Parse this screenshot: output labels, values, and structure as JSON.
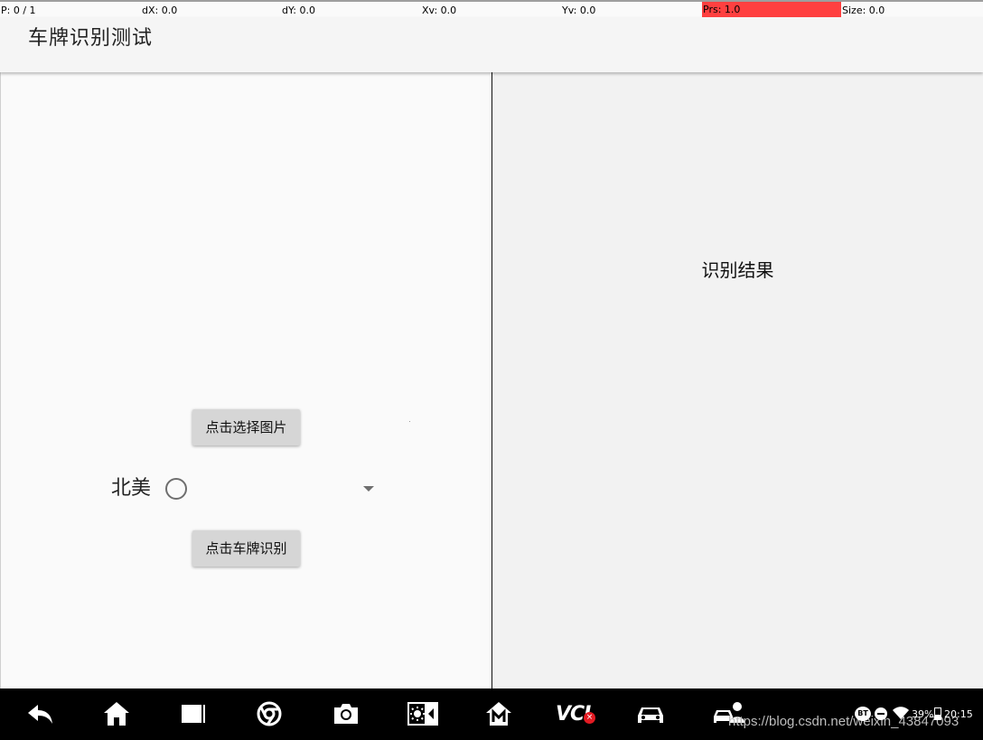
{
  "pointer_bar": {
    "pointer": "P: 0 / 1",
    "dx": "dX: 0.0",
    "dy": "dY: 0.0",
    "xv": "Xv: 0.0",
    "yv": "Yv: 0.0",
    "prs": "Prs: 1.0",
    "size": "Size: 0.0"
  },
  "app_bar": {
    "title": "车牌识别测试"
  },
  "left_pane": {
    "select_image_button": "点击选择图片",
    "region_label": "北美",
    "recognize_button": "点击车牌识别"
  },
  "right_pane": {
    "result_text": "识别结果"
  },
  "nav_bar": {
    "icons": [
      "back-icon",
      "home-icon",
      "recent-apps-icon",
      "browser-icon",
      "camera-icon",
      "brightness-icon",
      "m-home-icon",
      "vci-icon",
      "car-icon",
      "car-service-icon"
    ],
    "vci_label": "VCI",
    "vci_status": "×"
  },
  "status": {
    "bluetooth": "BT",
    "battery": "39%",
    "battery_level": 0.39,
    "time": "20:15"
  },
  "watermark": "https://blog.csdn.net/weixin_43847093",
  "colors": {
    "prs_highlight": "#ff4040",
    "nav_background": "#000000",
    "button": "#d6d6d6",
    "vci_badge": "#e31b23"
  }
}
